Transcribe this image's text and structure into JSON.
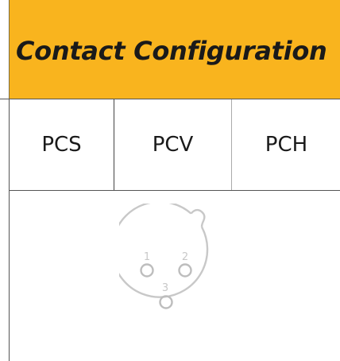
{
  "header": {
    "title": "Contact Configuration"
  },
  "variants": [
    "PCS",
    "PCV",
    "PCH"
  ],
  "diagram": {
    "pin_labels": [
      "1",
      "2",
      "3"
    ]
  },
  "colors": {
    "header_background": "#f9b41e",
    "text": "#1a1a1a",
    "border": "#555555",
    "diagram_stroke": "#c8c8c8"
  }
}
